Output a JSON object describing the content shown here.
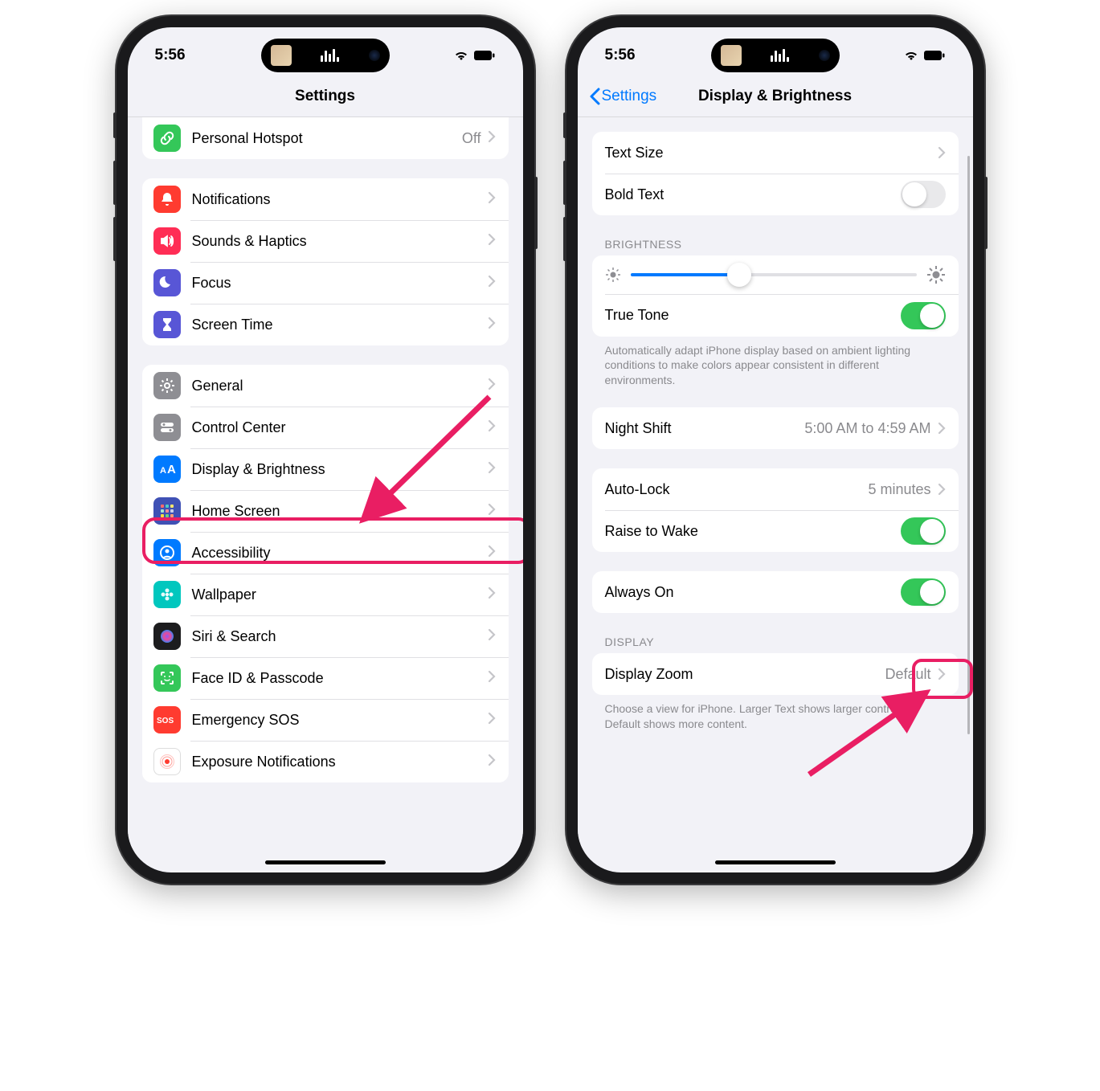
{
  "status": {
    "time": "5:56"
  },
  "phone1": {
    "nav_title": "Settings",
    "groups": [
      {
        "rows": [
          {
            "id": "personal-hotspot",
            "label": "Personal Hotspot",
            "value": "Off",
            "icon": "link",
            "icon_bg": "#34c759",
            "chevron": true
          }
        ]
      },
      {
        "rows": [
          {
            "id": "notifications",
            "label": "Notifications",
            "icon": "bell",
            "icon_bg": "#ff3b30",
            "chevron": true
          },
          {
            "id": "sounds-haptics",
            "label": "Sounds & Haptics",
            "icon": "speaker",
            "icon_bg": "#ff2d55",
            "chevron": true
          },
          {
            "id": "focus",
            "label": "Focus",
            "icon": "moon",
            "icon_bg": "#5856d6",
            "chevron": true
          },
          {
            "id": "screen-time",
            "label": "Screen Time",
            "icon": "hourglass",
            "icon_bg": "#5856d6",
            "chevron": true
          }
        ]
      },
      {
        "rows": [
          {
            "id": "general",
            "label": "General",
            "icon": "gear",
            "icon_bg": "#8e8e93",
            "chevron": true
          },
          {
            "id": "control-center",
            "label": "Control Center",
            "icon": "switches",
            "icon_bg": "#8e8e93",
            "chevron": true
          },
          {
            "id": "display-brightness",
            "label": "Display & Brightness",
            "icon": "aa",
            "icon_bg": "#007aff",
            "chevron": true,
            "highlighted": true
          },
          {
            "id": "home-screen",
            "label": "Home Screen",
            "icon": "apps",
            "icon_bg": "#3f51b5",
            "chevron": true
          },
          {
            "id": "accessibility",
            "label": "Accessibility",
            "icon": "person-circle",
            "icon_bg": "#007aff",
            "chevron": true
          },
          {
            "id": "wallpaper",
            "label": "Wallpaper",
            "icon": "flower",
            "icon_bg": "#00c7be",
            "chevron": true
          },
          {
            "id": "siri-search",
            "label": "Siri & Search",
            "icon": "siri",
            "icon_bg": "#1c1c1e",
            "chevron": true
          },
          {
            "id": "faceid-passcode",
            "label": "Face ID & Passcode",
            "icon": "faceid",
            "icon_bg": "#34c759",
            "chevron": true
          },
          {
            "id": "emergency-sos",
            "label": "Emergency SOS",
            "icon": "sos",
            "icon_bg": "#ff3b30",
            "chevron": true
          },
          {
            "id": "exposure-notifications",
            "label": "Exposure Notifications",
            "icon": "exposure",
            "icon_bg": "#fff",
            "chevron": true
          }
        ]
      }
    ]
  },
  "phone2": {
    "nav_back": "Settings",
    "nav_title": "Display & Brightness",
    "sections": {
      "text": {
        "text_size": "Text Size",
        "bold_text": "Bold Text",
        "bold_text_on": false
      },
      "brightness": {
        "header": "BRIGHTNESS",
        "slider_value": 0.38,
        "true_tone": "True Tone",
        "true_tone_on": true,
        "footer": "Automatically adapt iPhone display based on ambient lighting conditions to make colors appear consistent in different environments."
      },
      "night_shift": {
        "label": "Night Shift",
        "value": "5:00 AM to 4:59 AM"
      },
      "autolock": {
        "auto_lock": "Auto-Lock",
        "auto_lock_value": "5 minutes",
        "raise_to_wake": "Raise to Wake",
        "raise_to_wake_on": true
      },
      "always_on": {
        "label": "Always On",
        "on": true,
        "highlighted": true
      },
      "display": {
        "header": "DISPLAY",
        "display_zoom": "Display Zoom",
        "display_zoom_value": "Default",
        "footer": "Choose a view for iPhone. Larger Text shows larger controls. Default shows more content."
      }
    }
  },
  "colors": {
    "accent": "#e91e63",
    "ios_blue": "#007aff",
    "ios_green": "#34c759"
  }
}
